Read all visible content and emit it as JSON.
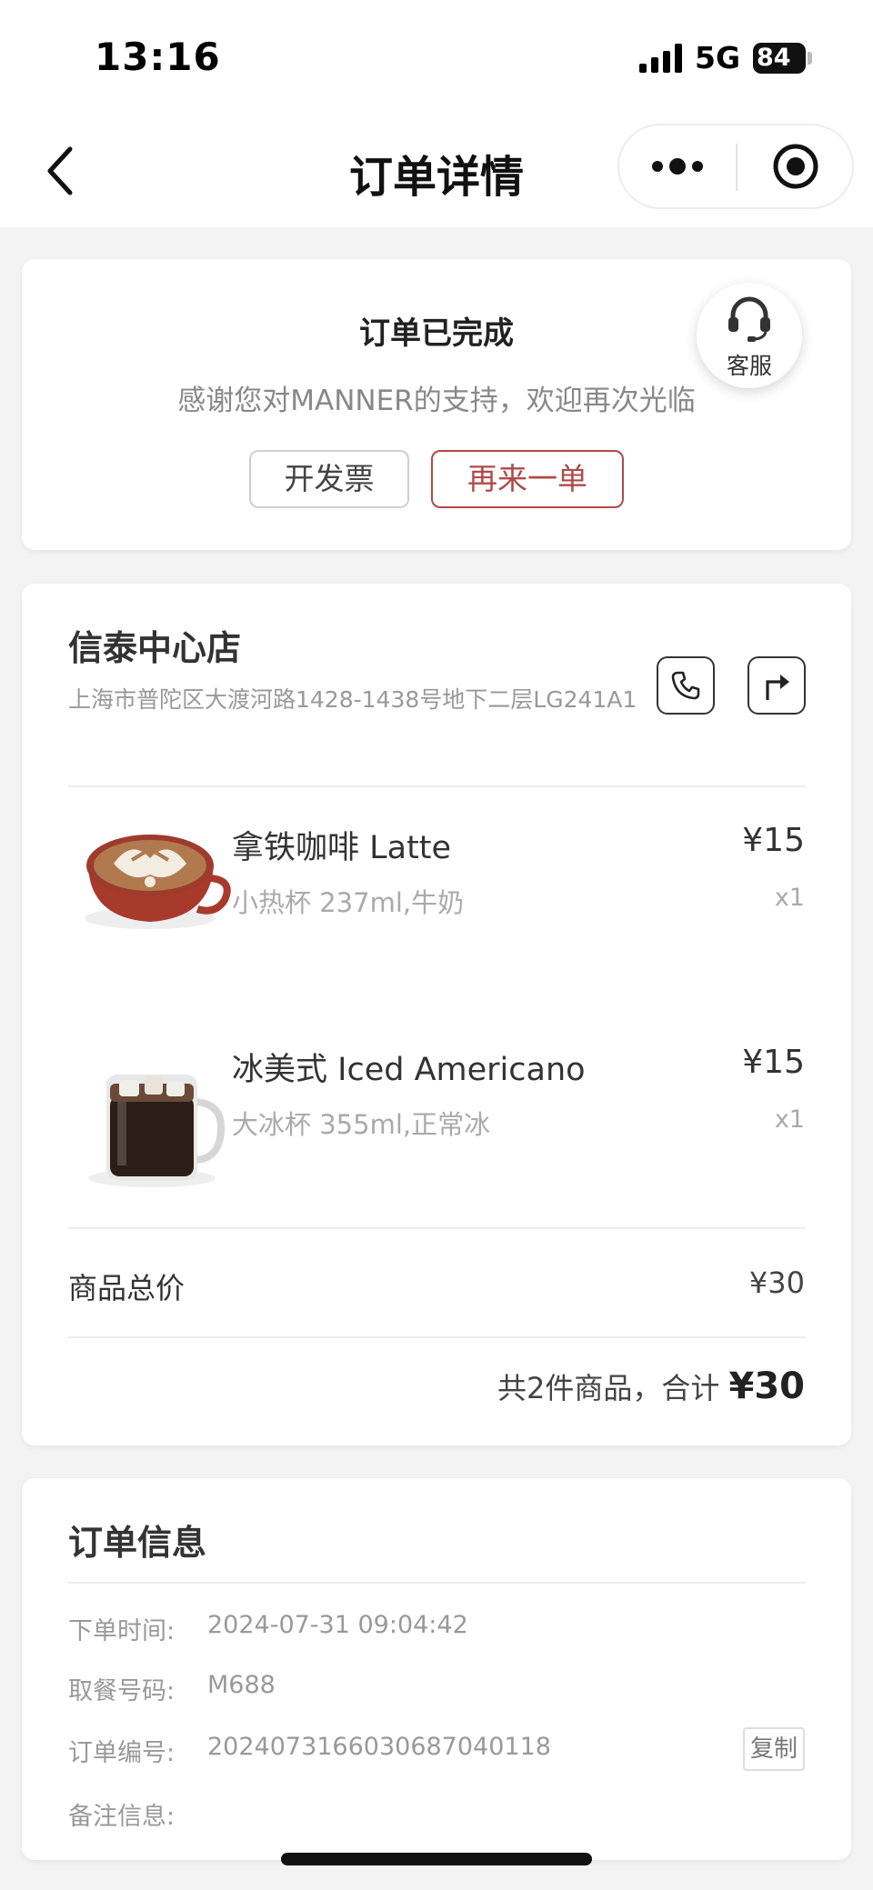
{
  "status_bar": {
    "time": "13:16",
    "network": "5G",
    "battery": "84"
  },
  "nav": {
    "title": "订单详情",
    "back_icon": "chevron-left-icon",
    "more_icon": "more-dots-icon",
    "close_icon": "target-circle-icon"
  },
  "order_status": {
    "title": "订单已完成",
    "subtitle": "感谢您对MANNER的支持，欢迎再次光临",
    "invoice_label": "开发票",
    "reorder_label": "再来一单",
    "service_label": "客服",
    "accent_color": "#b04a4a"
  },
  "store": {
    "name": "信泰中心店",
    "address": "上海市普陀区大渡河路1428-1438号地下二层LG241A1"
  },
  "items": [
    {
      "name": "拿铁咖啡 Latte",
      "spec": "小热杯 237ml,牛奶",
      "price": "¥15",
      "qty": "x1",
      "image_icon": "latte-cup-image"
    },
    {
      "name": "冰美式 Iced Americano",
      "spec": "大冰杯 355ml,正常冰",
      "price": "¥15",
      "qty": "x1",
      "image_icon": "iced-americano-glass-image"
    }
  ],
  "summary": {
    "subtotal_label": "商品总价",
    "subtotal_value": "¥30",
    "total_prefix": "共2件商品，合计",
    "total_value": "¥30"
  },
  "order_info": {
    "title": "订单信息",
    "time_label": "下单时间:",
    "time_value": "2024-07-31 09:04:42",
    "pickup_label": "取餐号码:",
    "pickup_value": "M688",
    "order_no_label": "订单编号:",
    "order_no_value": "20240731660306870401​18",
    "copy_label": "复制",
    "remark_label": "备注信息:",
    "remark_value": ""
  }
}
